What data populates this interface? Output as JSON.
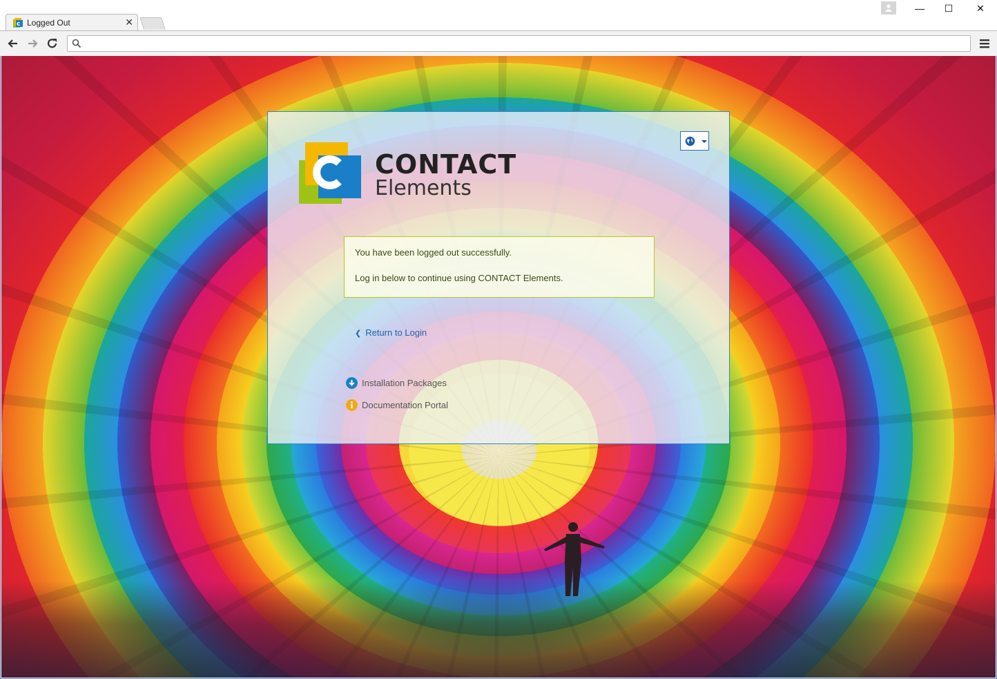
{
  "browser": {
    "tab_title": "Logged Out",
    "tab_close": "✕",
    "omnibox_placeholder": "",
    "omnibox_value": ""
  },
  "window_controls": {
    "minimize": "—",
    "maximize": "☐",
    "close": "✕"
  },
  "page": {
    "brand": {
      "name": "CONTACT",
      "product": "Elements"
    },
    "language_button_icon": "globe-icon",
    "message": {
      "line1": "You have been logged out successfully.",
      "line2": "Log in below to continue using CONTACT Elements."
    },
    "return_link": "Return to Login",
    "resources": [
      {
        "label": "Installation Packages",
        "icon": "download-icon",
        "color": "#1a7ec8"
      },
      {
        "label": "Documentation Portal",
        "icon": "info-icon",
        "color": "#f2a818"
      }
    ]
  },
  "colors": {
    "accent_blue": "#2f86c8",
    "link": "#1f62a8",
    "message_border": "#b8c32a",
    "logo_yellow": "#f5b800",
    "logo_blue": "#1a7ec8",
    "logo_green": "#9ec316"
  }
}
